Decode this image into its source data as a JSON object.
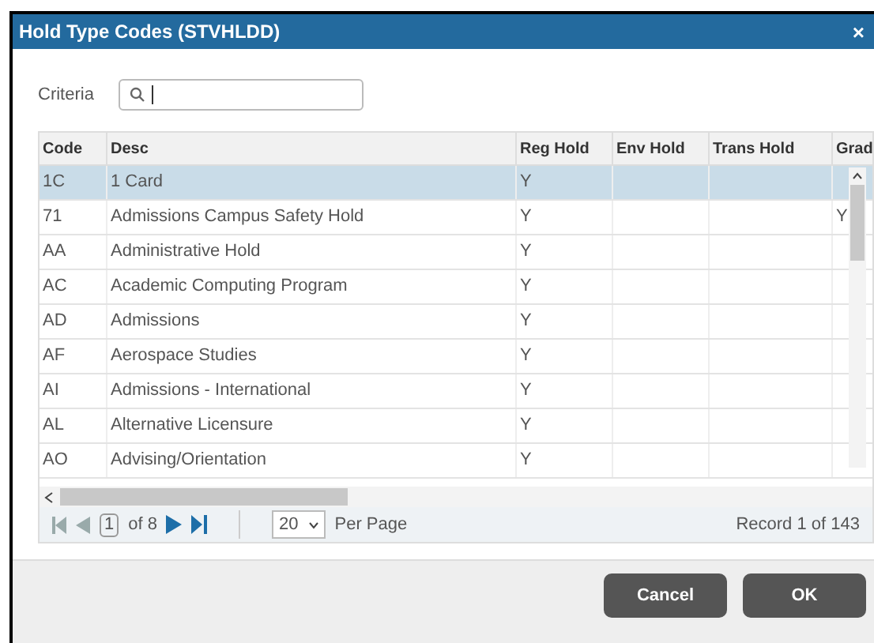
{
  "window": {
    "title": "Hold Type Codes (STVHLDD)",
    "close": "×"
  },
  "criteria": {
    "label": "Criteria"
  },
  "table": {
    "columns": [
      "Code",
      "Desc",
      "Reg Hold",
      "Env Hold",
      "Trans Hold",
      "Grad"
    ],
    "rows": [
      {
        "cells": [
          "1C",
          "1 Card",
          "Y",
          "",
          "",
          ""
        ],
        "selected": true
      },
      {
        "cells": [
          "71",
          "Admissions Campus Safety Hold",
          "Y",
          "",
          "",
          "Y"
        ],
        "selected": false
      },
      {
        "cells": [
          "AA",
          "Administrative Hold",
          "Y",
          "",
          "",
          ""
        ],
        "selected": false
      },
      {
        "cells": [
          "AC",
          "Academic Computing Program",
          "Y",
          "",
          "",
          ""
        ],
        "selected": false
      },
      {
        "cells": [
          "AD",
          "Admissions",
          "Y",
          "",
          "",
          ""
        ],
        "selected": false
      },
      {
        "cells": [
          "AF",
          "Aerospace Studies",
          "Y",
          "",
          "",
          ""
        ],
        "selected": false
      },
      {
        "cells": [
          "AI",
          "Admissions - International",
          "Y",
          "",
          "",
          ""
        ],
        "selected": false
      },
      {
        "cells": [
          "AL",
          "Alternative Licensure",
          "Y",
          "",
          "",
          ""
        ],
        "selected": false
      },
      {
        "cells": [
          "AO",
          "Advising/Orientation",
          "Y",
          "",
          "",
          ""
        ],
        "selected": false
      }
    ]
  },
  "pagination": {
    "page": "1",
    "of_pages": "of 8",
    "per_page": "20",
    "per_page_label": "Per Page",
    "record": "Record 1 of 143"
  },
  "buttons": [
    "Cancel",
    "OK"
  ]
}
